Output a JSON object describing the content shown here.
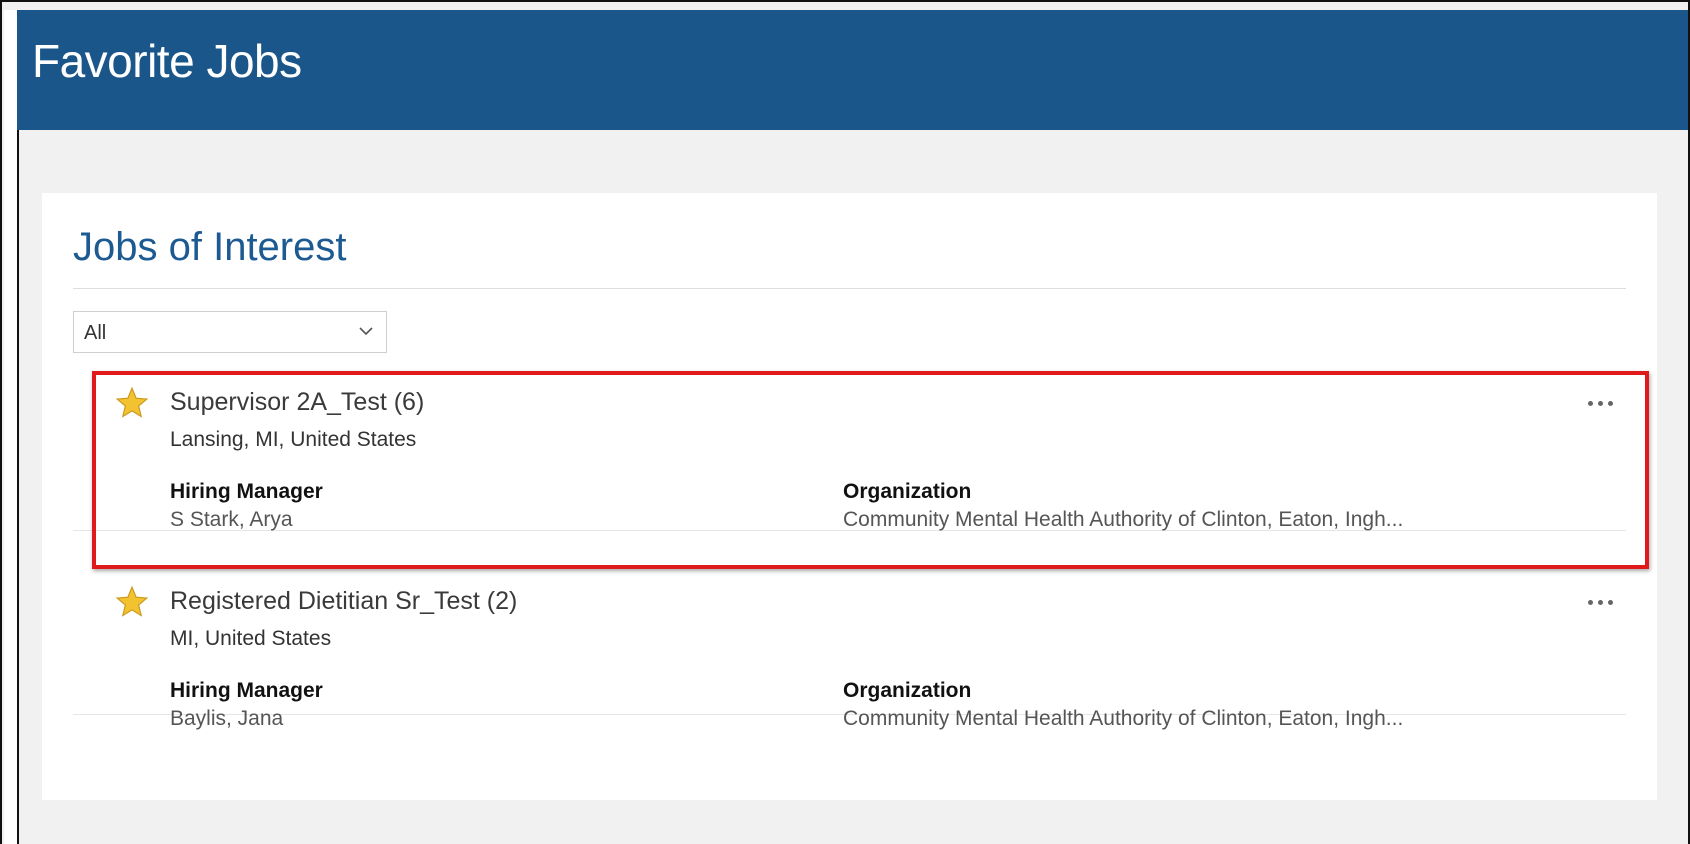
{
  "header": {
    "title": "Favorite Jobs"
  },
  "section": {
    "title": "Jobs of Interest"
  },
  "filter": {
    "selected": "All"
  },
  "jobs": [
    {
      "title": "Supervisor 2A_Test (6)",
      "location": "Lansing, MI, United States",
      "hiring_manager_label": "Hiring Manager",
      "hiring_manager": "S Stark, Arya",
      "organization_label": "Organization",
      "organization": "Community Mental Health Authority of Clinton, Eaton, Ingh...",
      "favorited": true,
      "highlighted": true
    },
    {
      "title": "Registered Dietitian Sr_Test (2)",
      "location": "MI, United States",
      "hiring_manager_label": "Hiring Manager",
      "hiring_manager": "Baylis, Jana",
      "organization_label": "Organization",
      "organization": "Community Mental Health Authority of Clinton, Eaton, Ingh...",
      "favorited": true,
      "highlighted": false
    }
  ],
  "colors": {
    "header_bg": "#1a5689",
    "section_title": "#1d5a92",
    "star": "#f2c230",
    "highlight_border": "#e01a1a"
  },
  "icons": {
    "star": "star-icon",
    "more": "more-actions-icon",
    "chevron": "chevron-down-icon"
  }
}
